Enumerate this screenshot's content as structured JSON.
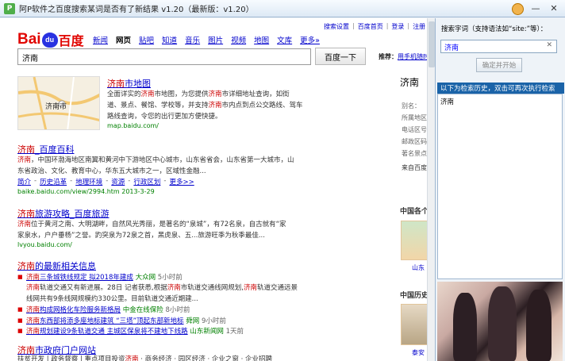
{
  "window": {
    "app_icon": "P",
    "title": "阿P软件之百度搜索某词是否有了新结果 v1.20（最新版：v1.20）",
    "minimize": "—",
    "close": "✕"
  },
  "baidu": {
    "logo_bai": "Bai",
    "logo_du": "du",
    "logo_cn": "百度",
    "nav": [
      "新闻",
      "网页",
      "贴吧",
      "知道",
      "音乐",
      "图片",
      "视频",
      "地图",
      "文库",
      "更多»"
    ],
    "nav_current": 1,
    "top_links": [
      "搜索设置",
      "百度首页",
      "登录",
      "注册"
    ],
    "query": "济南",
    "search_button": "百度一下",
    "recommend_label": "推荐：",
    "recommend_link": "用手机随时"
  },
  "results": {
    "map_label": "济南市",
    "r1_title": "济南市地图",
    "r1_lines": [
      "全面详实的济南市地图，为您提供济南市详细地址查询，如街",
      "道、景点、餐馆、学校等，并支持济南市内点到点公交路线、驾车",
      "路线查询，令您的出行更加方便快捷。"
    ],
    "r1_url": "map.baidu.com/",
    "r2_title_hl": "济南",
    "r2_title_rest": "_百度百科",
    "r2_lines": [
      "济南，中国环渤海地区南翼和黄河中下游地区中心城市，山东省省会，山东省第一大城市，山",
      "东省政治、文化、教育中心，华东五大城市之一，区域性金融..."
    ],
    "r2_sublinks": [
      "简介",
      "历史沿革",
      "地理环境",
      "资源",
      "行政区划",
      "更多>>"
    ],
    "r2_url": "baike.baidu.com/view/2994.htm 2013-3-29",
    "r3_title": "济南旅游攻略_百度旅游",
    "r3_lines": [
      "济南位于黄河之南、大明湖畔，自然风光秀丽，是著名的“泉城”，有72名泉，自古就有“家",
      "家泉水，户户垂杨”之誉。趵突泉为72泉之首，黑虎泉、五...旅游旺季为秋季最佳..."
    ],
    "r3_url": "lvyou.baidu.com/",
    "r4_title": "济南的最新相关信息",
    "news": [
      {
        "link": "济南三条城铁线规定 拟2018年建成",
        "src": "大众网",
        "time": "5小时前"
      },
      {
        "link": "济南构成网格化车险服务新格局",
        "src": "中金在线保险",
        "time": "8小时前"
      },
      {
        "link": "济南东西部将添多座地标建筑 “三塔”顶起东部新地标",
        "src": "舜网",
        "time": "9小时前"
      },
      {
        "link": "济南规划建设9条轨道交通 主城区保泉将不建地下线路",
        "src": "山东新闻网",
        "time": "1天前"
      }
    ],
    "news_text": [
      "济南轨道交通又有新进展。28日 记者获悉,根据济南市轨道交通线网规划,济南轨道交通远景",
      "线网共有9条线网规模约330公里。目前轨道交通近期建..."
    ],
    "r5_title": "济南市政府门户网站",
    "r5_line": "扶贫开发 | 政务督察 | 重点项目投资济南 · 商务经济 · 园区经济 · 企业之窗 · 企业招聘"
  },
  "right_panel": {
    "title": "济南",
    "attrs": [
      "别名：",
      "所属地区",
      "电话区号",
      "邮政区码",
      "著名景点",
      "来自百度"
    ],
    "h1": "中国各个",
    "cap1": "山东",
    "h2": "中国历史",
    "cap2": "泰安"
  },
  "side_panel": {
    "label": "搜索字词（支持语法如“site:”等）：",
    "input_value": "济南",
    "clear": "✕",
    "start_button": "确定并开始",
    "history_bar": "以下为检索历史，双击可再次执行检索",
    "history": [
      "济南"
    ]
  },
  "colors": {
    "accent": "#1a63a8",
    "link": "#0000cc",
    "highlight": "#cc0000",
    "url": "#008000"
  }
}
